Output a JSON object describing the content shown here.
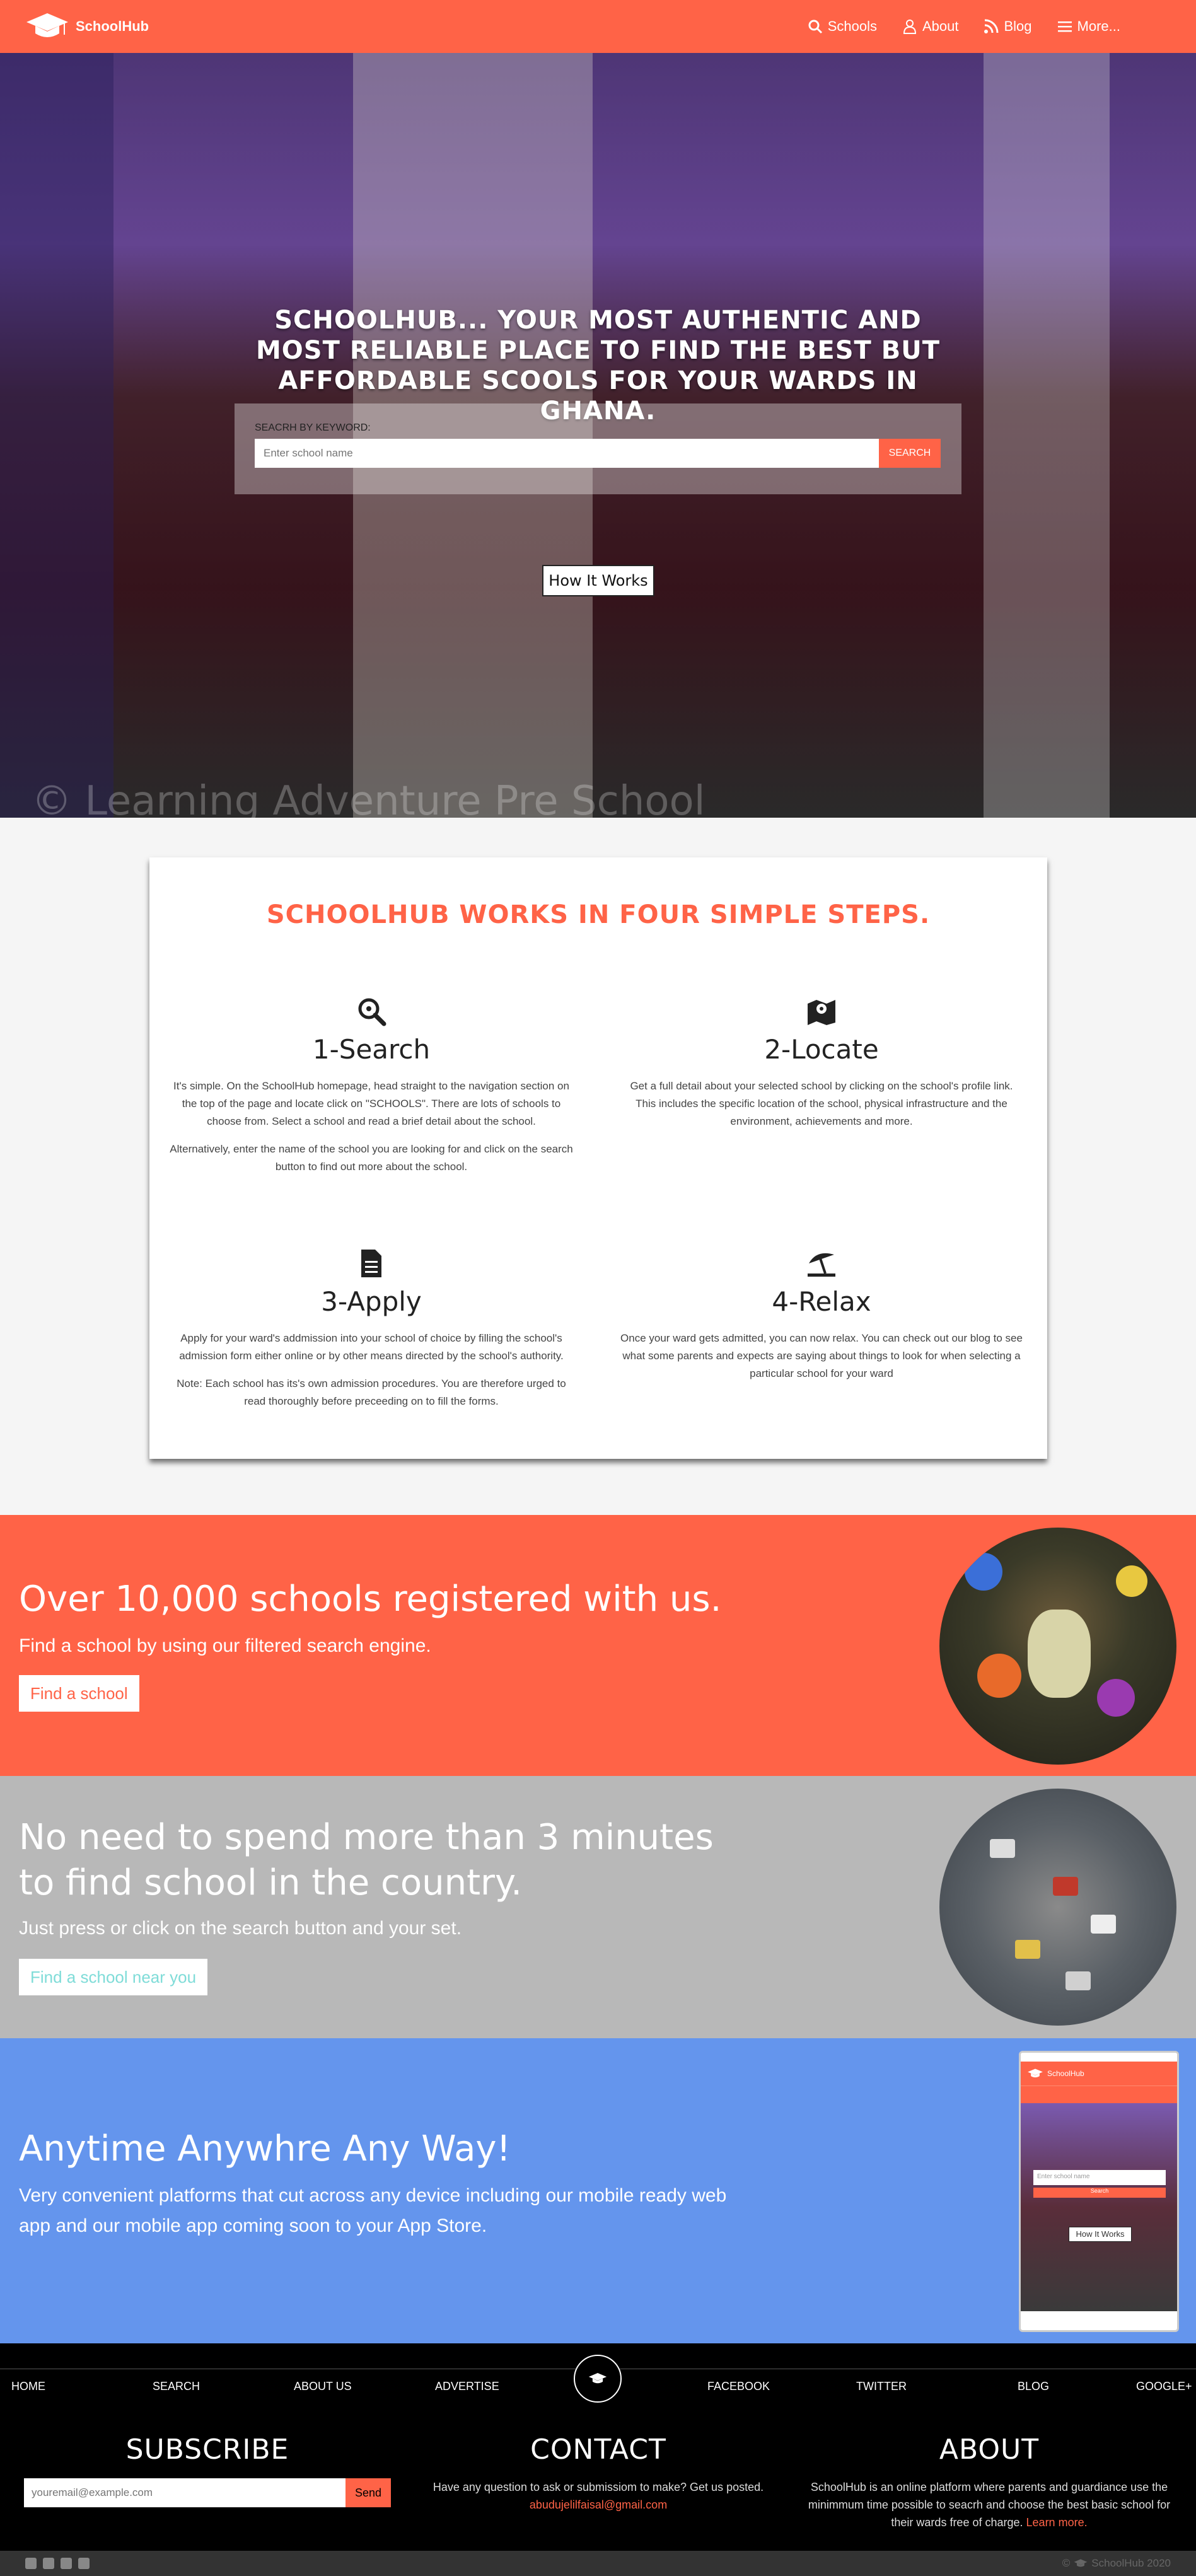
{
  "nav": {
    "brand": "SchoolHub",
    "links": [
      {
        "label": "Schools",
        "icon": "search-icon"
      },
      {
        "label": "About",
        "icon": "user-icon"
      },
      {
        "label": "Blog",
        "icon": "rss-icon"
      },
      {
        "label": "More...",
        "icon": "menu-icon"
      }
    ]
  },
  "hero": {
    "title": "SchoolHub... your most authentic and most reliable place to find the best but affordable scools for your wards in Ghana.",
    "search_label": "Seacrh by keyword:",
    "search_placeholder": "Enter school name",
    "search_button": "Search",
    "how_button": "How It Works",
    "watermark": "© Learning Adventure Pre School"
  },
  "steps": {
    "title": "SchoolHub works in four simple steps.",
    "items": [
      {
        "icon": "magnifier-icon",
        "title": "1-Search",
        "paragraphs": [
          "It's simple. On the SchoolHub homepage, head straight to the navigation section on the top of the page and locate click on \"SCHOOLS\". There are lots of schools to choose from. Select a school and read a brief detail about the school.",
          "Alternatively, enter the name of the school you are looking for and click on the search button to find out more about the school."
        ]
      },
      {
        "icon": "map-marker-icon",
        "title": "2-Locate",
        "paragraphs": [
          "Get a full detail about your selected school by clicking on the school's profile link. This includes the specific location of the school, physical infrastructure and the environment, achievements and more."
        ]
      },
      {
        "icon": "document-icon",
        "title": "3-Apply",
        "paragraphs": [
          "Apply for your ward's addmission into your school of choice by filling the school's admission form either online or by other means directed by the school's authority.",
          "Note: Each school has its's own admission procedures. You are therefore urged to read thoroughly before preceeding on to fill the forms."
        ]
      },
      {
        "icon": "umbrella-beach-icon",
        "title": "4-Relax",
        "paragraphs": [
          "Once your ward gets admitted, you can now relax. You can check out our blog to see what some parents and expects are saying about things to look for when selecting a particular school for your ward"
        ]
      }
    ]
  },
  "bands": {
    "registered": {
      "heading": "Over 10,000 schools registered with us.",
      "sub": "Find a school by using our filtered search engine.",
      "cta": "Find a school"
    },
    "minutes": {
      "heading": "No need to spend more than 3 minutes to find school in the country.",
      "sub": "Just press or click on the search button and your set.",
      "cta": "Find a school near you"
    },
    "anywhere": {
      "heading": "Anytime Anywhre Any Way!",
      "sub": "Very convenient platforms that cut across any device including our mobile ready web app and our mobile app coming soon to your App Store.",
      "phone_brand": "SchoolHub",
      "phone_placeholder": "Enter school name",
      "phone_search": "Search",
      "phone_how": "How It Works"
    }
  },
  "footer_nav": [
    "Home",
    "Search",
    "About Us",
    "Advertise",
    "Facebook",
    "Twitter",
    "Blog",
    "Google+"
  ],
  "footer": {
    "subscribe": {
      "title": "Subscribe",
      "placeholder": "youremail@example.com",
      "button": "Send"
    },
    "contact": {
      "title": "Contact",
      "text": "Have any question to ask or submissiom to make? Get us posted.",
      "email": "abudujelilfaisal@gmail.com"
    },
    "about": {
      "title": "About",
      "text": "SchoolHub is an online platform where parents and guardiance use the minimmum time possible to seacrh and choose the best basic school for their wards free of charge.",
      "link": "Learn more."
    }
  },
  "bottom": {
    "copyright": "SchoolHub 2020",
    "socials": [
      "github-icon",
      "linkedin-icon",
      "twitter-icon",
      "facebook-icon"
    ]
  },
  "colors": {
    "accent": "#ff6347",
    "grey_band": "#b8b8b8",
    "blue_band": "#6495ed",
    "footer": "#000000"
  }
}
